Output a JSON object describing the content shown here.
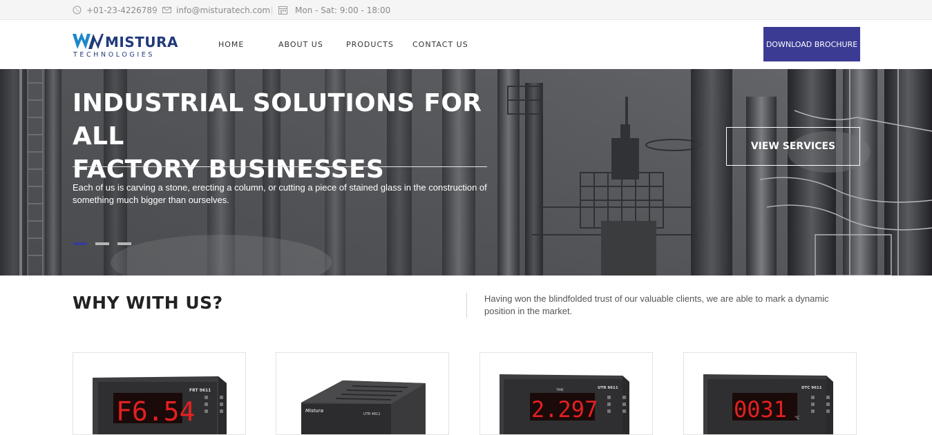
{
  "topbar": {
    "phone": "+01-23-4226789",
    "email": "info@misturatech.com",
    "hours": "Mon - Sat: 9:00 - 18:00"
  },
  "brand": {
    "name": "MISTURA",
    "tagline": "TECHNOLOGIES",
    "color": "#213a7a",
    "accent": "#1e88c9"
  },
  "nav": {
    "items": [
      {
        "label": "HOME"
      },
      {
        "label": "ABOUT US"
      },
      {
        "label": "PRODUCTS"
      },
      {
        "label": "CONTACT US"
      }
    ],
    "cta_label": "DOWNLOAD BROCHURE",
    "cta_color": "#3c3b94"
  },
  "hero": {
    "title_line1": "INDUSTRIAL SOLUTIONS FOR ALL",
    "title_line2": "FACTORY BUSINESSES",
    "text": "Each of us is carving a stone, erecting a column, or cutting a piece of stained glass in the construction of something much bigger than ourselves.",
    "button_label": "VIEW SERVICES",
    "slides_total": 3,
    "active_slide": 1
  },
  "why": {
    "title": "WHY WITH US?",
    "text": "Having won the blindfolded trust of our valuable clients, we are able to mark a dynamic position in the market."
  },
  "products": [
    {
      "model": "FRT 9611",
      "display": "F6.54"
    },
    {
      "model": "UTR 4811",
      "display": "",
      "brand": "Mistura"
    },
    {
      "model": "UTR 9611",
      "display": "2.297",
      "label": "TIME"
    },
    {
      "model": "DTC 9611",
      "display": "0031",
      "unit": "°C"
    }
  ]
}
